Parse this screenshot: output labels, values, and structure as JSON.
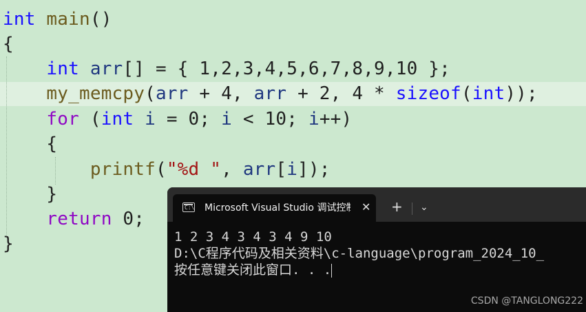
{
  "editor": {
    "l1": {
      "t1": "int",
      "t2": " ",
      "t3": "main",
      "t4": "()"
    },
    "l2": {
      "t1": "{"
    },
    "l3": {
      "t1": "    ",
      "t2": "int",
      "t3": " ",
      "t4": "arr",
      "t5": "[] = { 1,2,3,4,5,6,7,8,9,10 };"
    },
    "l4": {
      "t1": "    ",
      "t2": "my_memcpy",
      "t3": "(",
      "t4": "arr",
      "t5": " + 4, ",
      "t6": "arr",
      "t7": " + 2, 4 * ",
      "t8": "sizeof",
      "t9": "(",
      "t10": "int",
      "t11": "));"
    },
    "l5": {
      "t1": "    ",
      "t2": "for",
      "t3": " (",
      "t4": "int",
      "t5": " ",
      "t6": "i",
      "t7": " = 0; ",
      "t8": "i",
      "t9": " < 10; ",
      "t10": "i",
      "t11": "++)"
    },
    "l6": {
      "t1": "    {"
    },
    "l7": {
      "t1": "        ",
      "t2": "printf",
      "t3": "(",
      "t4": "\"%d \"",
      "t5": ", ",
      "t6": "arr",
      "t7": "[",
      "t8": "i",
      "t9": "]);"
    },
    "l8": {
      "t1": "    }"
    },
    "l9": {
      "t1": "    ",
      "t2": "return",
      "t3": " 0;"
    },
    "l10": {
      "t1": "}"
    }
  },
  "terminal": {
    "tab_icon_text": "C:\\",
    "tab_title": "Microsoft Visual Studio 调试控制台",
    "close_glyph": "✕",
    "new_tab_glyph": "+",
    "dropdown_glyph": "⌄",
    "lines": [
      "1 2 3 4 3 4 3 4 9 10",
      "D:\\C程序代码及相关资料\\c-language\\program_2024_10_",
      "按任意键关闭此窗口. . ."
    ]
  },
  "watermark": "CSDN @TANGLONG222",
  "colors": {
    "editor_bg": "#cce8cf",
    "keyword": "#1a10ff",
    "keyword_control": "#8f08c4",
    "function": "#6b5b1e",
    "identifier": "#1f377f",
    "string": "#a31515",
    "terminal_bg": "#0c0c0c"
  }
}
